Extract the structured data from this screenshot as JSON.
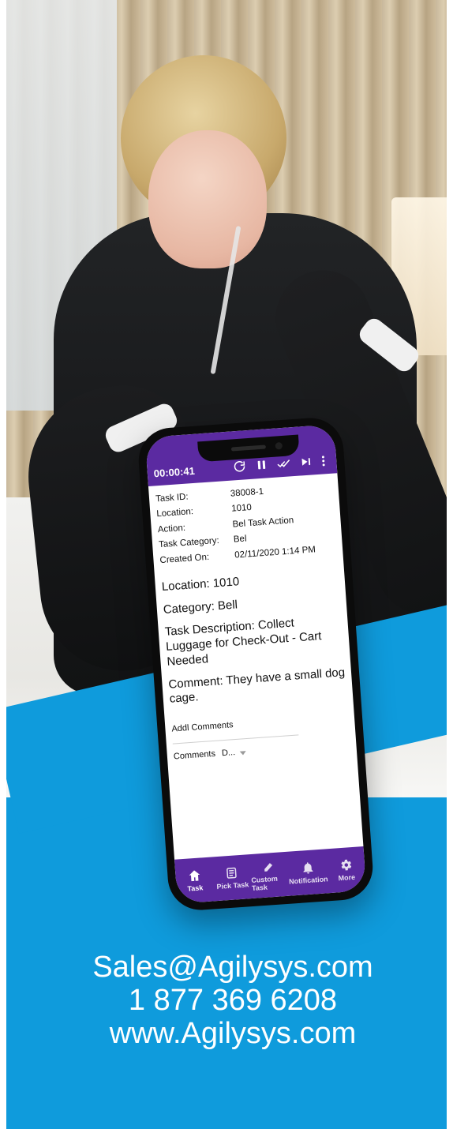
{
  "colors": {
    "brand_blue": "#0F9BDC",
    "app_purple": "#5B2AA1"
  },
  "phone": {
    "timer": "00:00:41",
    "top_icons": [
      "refresh-icon",
      "pause-icon",
      "check-double-icon",
      "skip-next-icon",
      "more-vert-icon"
    ],
    "task": {
      "fields": [
        {
          "label": "Task ID:",
          "value": "38008-1"
        },
        {
          "label": "Location:",
          "value": "1010"
        },
        {
          "label": "Action:",
          "value": "Bel Task Action"
        },
        {
          "label": "Task Category:",
          "value": "Bel"
        },
        {
          "label": "Created On:",
          "value": "02/11/2020 1:14 PM"
        }
      ],
      "location_line": "Location:  1010",
      "category_line": "Category: Bell",
      "description_line": "Task Description: Collect Luggage for Check-Out - Cart Needed",
      "comment_line": "Comment: They have a small dog cage."
    },
    "addl_comments_label": "Addl Comments",
    "comments_label": "Comments",
    "comments_selected": "D...",
    "bottom_nav": [
      {
        "label": "Task",
        "icon": "home-icon"
      },
      {
        "label": "Pick Task",
        "icon": "task-list-icon"
      },
      {
        "label": "Custom Task",
        "icon": "edit-icon"
      },
      {
        "label": "Notification",
        "icon": "bell-icon"
      },
      {
        "label": "More",
        "icon": "gear-icon"
      }
    ]
  },
  "contact": {
    "email": "Sales@Agilysys.com",
    "phone": "1 877 369 6208",
    "website": "www.Agilysys.com"
  }
}
